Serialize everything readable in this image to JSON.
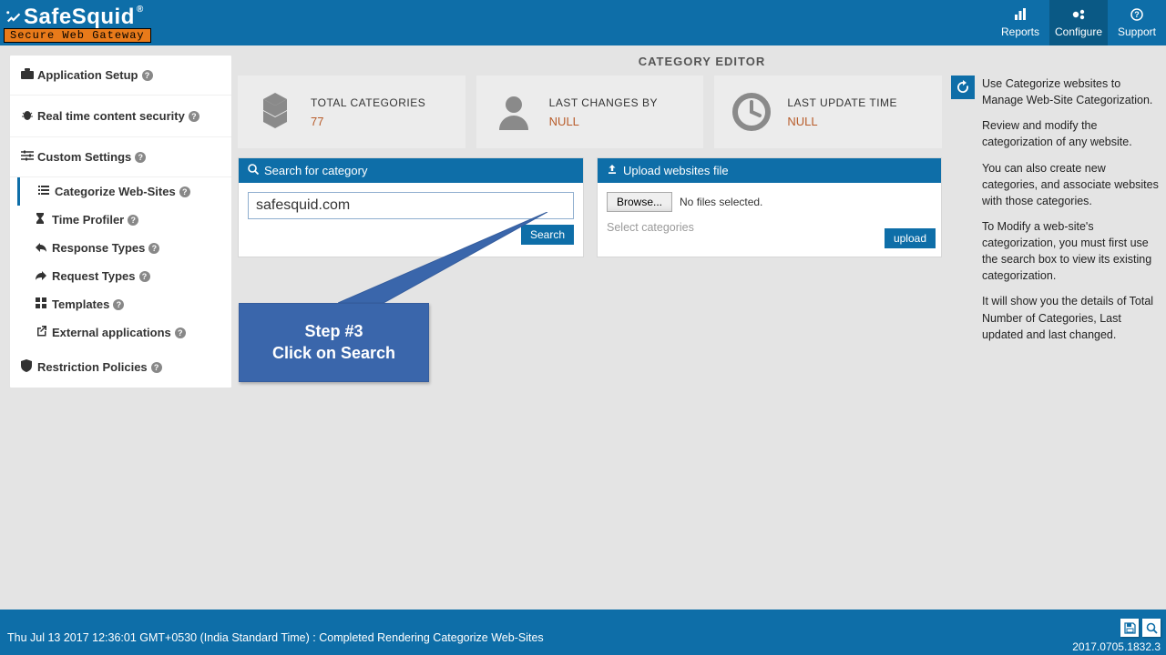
{
  "brand": {
    "name": "SafeSquid",
    "reg": "®",
    "tagline": "Secure Web Gateway"
  },
  "topnav": {
    "reports": "Reports",
    "configure": "Configure",
    "support": "Support"
  },
  "sidebar": {
    "groups": {
      "app_setup": "Application Setup",
      "rt_security": "Real time content security",
      "custom": "Custom Settings",
      "restriction": "Restriction Policies"
    },
    "custom_items": {
      "categorize": "Categorize Web-Sites",
      "time_profiler": "Time Profiler",
      "response_types": "Response Types",
      "request_types": "Request Types",
      "templates": "Templates",
      "external_apps": "External applications"
    }
  },
  "page": {
    "title": "CATEGORY EDITOR"
  },
  "stats": {
    "total_categories": {
      "label": "TOTAL CATEGORIES",
      "value": "77"
    },
    "last_changes_by": {
      "label": "LAST CHANGES BY",
      "value": "NULL"
    },
    "last_update_time": {
      "label": "LAST UPDATE TIME",
      "value": "NULL"
    }
  },
  "help": {
    "p1": "Use Categorize websites to Manage Web-Site Categorization.",
    "p2": "Review and modify the categorization of any website.",
    "p3": "You can also create new categories, and associate websites with those categories.",
    "p4": "To Modify a web-site's categorization, you must first use the search box to view its existing categorization.",
    "p5": "It will show you the details of Total Number of Categories, Last updated and last changed."
  },
  "search_panel": {
    "header": "Search for category",
    "input_value": "safesquid.com",
    "search_btn": "Search"
  },
  "upload_panel": {
    "header": "Upload websites file",
    "browse_btn": "Browse...",
    "no_files": "No files selected.",
    "select_cats": "Select categories",
    "upload_btn": "upload"
  },
  "callout": {
    "line1": "Step #3",
    "line2": "Click on Search"
  },
  "footer": {
    "status": "Thu Jul 13 2017 12:36:01 GMT+0530 (India Standard Time) : Completed Rendering Categorize Web-Sites",
    "version": "2017.0705.1832.3"
  }
}
